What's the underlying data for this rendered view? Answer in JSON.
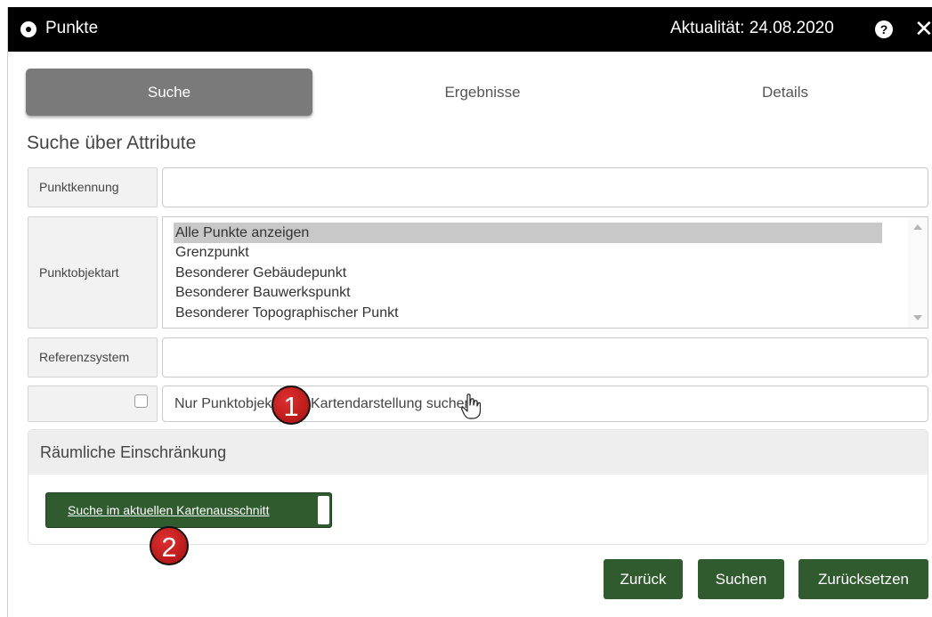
{
  "window": {
    "title": "Punkte",
    "date_label": "Aktualität: 24.08.2020",
    "help_glyph": "?",
    "close_glyph": "✕"
  },
  "tabs": [
    {
      "label": "Suche",
      "active": true
    },
    {
      "label": "Ergebnisse",
      "active": false
    },
    {
      "label": "Details",
      "active": false
    }
  ],
  "form": {
    "heading": "Suche über Attribute",
    "punktkennung": {
      "label": "Punktkennung",
      "value": ""
    },
    "punktobjektart": {
      "label": "Punktobjektart",
      "options": [
        "Alle Punkte anzeigen",
        "Grenzpunkt",
        "Besonderer Gebäudepunkt",
        "Besonderer Bauwerkspunkt",
        "Besonderer Topographischer Punkt"
      ],
      "selected": "Alle Punkte anzeigen"
    },
    "referenzsystem": {
      "label": "Referenzsystem",
      "value": ""
    },
    "kartendarstellung": {
      "label": "Nur Punktobjekte mit Kartendarstellung suchen",
      "checked": false
    }
  },
  "spatial": {
    "heading": "Räumliche Einschränkung",
    "button_label": "Suche im aktuellen Kartenausschnitt"
  },
  "actions": {
    "back": "Zurück",
    "search": "Suchen",
    "reset": "Zurücksetzen"
  },
  "annotations": {
    "marker_1": "1",
    "marker_2": "2"
  },
  "colors": {
    "titlebar": "#000000",
    "active_tab": "#7a7a7a",
    "primary_green": "#2f5b2f",
    "marker_red": "#c41c1c"
  }
}
